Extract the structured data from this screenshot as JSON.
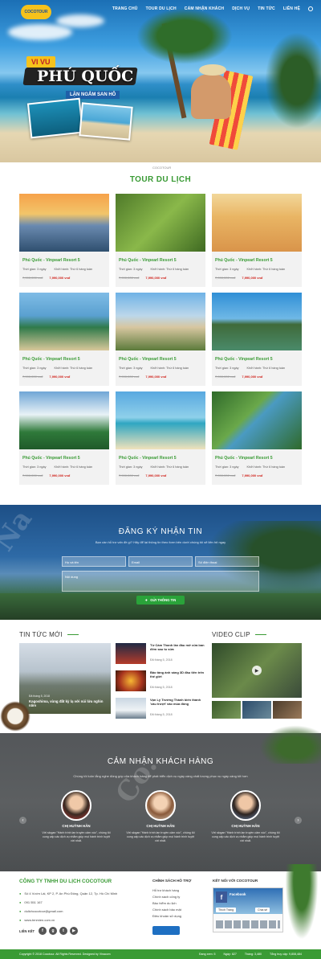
{
  "nav": {
    "items": [
      "TRANG CHỦ",
      "TOUR DU LỊCH",
      "CẨM NHẬN KHÁCH",
      "DỊCH VỤ",
      "TIN TỨC",
      "LIÊN HỆ"
    ],
    "logo": "COCOTOUR"
  },
  "hero": {
    "tag": "VI VU",
    "title": "PHÚ QUỐC",
    "subtitle": "LẶN NGẮM SAN HÔ"
  },
  "tour": {
    "mini_logo": "COCOTOUR",
    "title": "TOUR DU LỊCH",
    "cards": [
      {
        "name": "Phú Quốc - Vinpearl Resort 5",
        "duration": "Thời gian: 3 ngày",
        "depart": "Khởi hành: Thứ 6 hàng tuần",
        "old_price": "7,990,000 vnđ",
        "new_price": "7,990,000 vnđ",
        "img": "sunset"
      },
      {
        "name": "Phú Quốc - Vinpearl Resort 5",
        "duration": "Thời gian: 3 ngày",
        "depart": "Khởi hành: Thứ 6 hàng tuần",
        "old_price": "7,990,000 vnđ",
        "new_price": "7,990,000 vnđ",
        "img": "grapes"
      },
      {
        "name": "Phú Quốc - Vinpearl Resort 5",
        "duration": "Thời gian: 3 ngày",
        "depart": "Khởi hành: Thứ 6 hàng tuần",
        "old_price": "7,990,000 vnđ",
        "new_price": "7,990,000 vnđ",
        "img": "dunes"
      },
      {
        "name": "Phú Quốc - Vinpearl Resort 5",
        "duration": "Thời gian: 3 ngày",
        "depart": "Khởi hành: Thứ 6 hàng tuần",
        "old_price": "7,990,000 vnđ",
        "new_price": "7,990,000 vnđ",
        "img": "bay"
      },
      {
        "name": "Phú Quốc - Vinpearl Resort 5",
        "duration": "Thời gian: 3 ngày",
        "depart": "Khởi hành: Thứ 6 hàng tuần",
        "old_price": "7,990,000 vnđ",
        "new_price": "7,990,000 vnđ",
        "img": "temple"
      },
      {
        "name": "Phú Quốc - Vinpearl Resort 5",
        "duration": "Thời gian: 3 ngày",
        "depart": "Khởi hành: Thứ 6 hàng tuần",
        "old_price": "7,990,000 vnđ",
        "new_price": "7,990,000 vnđ",
        "img": "lake"
      },
      {
        "name": "Phú Quốc - Vinpearl Resort 5",
        "duration": "Thời gian: 3 ngày",
        "depart": "Khởi hành: Thứ 6 hàng tuần",
        "old_price": "7,990,000 vnđ",
        "new_price": "7,990,000 vnđ",
        "img": "waterfall"
      },
      {
        "name": "Phú Quốc - Vinpearl Resort 5",
        "duration": "Thời gian: 3 ngày",
        "depart": "Khởi hành: Thứ 6 hàng tuần",
        "old_price": "7,990,000 vnđ",
        "new_price": "7,990,000 vnđ",
        "img": "beach"
      },
      {
        "name": "Phú Quốc - Vinpearl Resort 5",
        "duration": "Thời gian: 3 ngày",
        "depart": "Khởi hành: Thứ 6 hàng tuần",
        "old_price": "7,990,000 vnđ",
        "new_price": "7,990,000 vnđ",
        "img": "river"
      }
    ]
  },
  "newsletter": {
    "title": "ĐĂNG KÝ NHẬN TIN",
    "subtitle": "Bạn cần hỗ trợ vấn đề gì? Hãy để lại thông tin theo form bên dưới chúng tôi sẽ liên hệ ngay",
    "name_placeholder": "Họ và tên",
    "email_placeholder": "Email",
    "phone_placeholder": "Số điện thoại",
    "content_placeholder": "Nội dung",
    "submit": "GỬI THÔNG TIN"
  },
  "news": {
    "title": "TIN TỨC MỚI",
    "featured": {
      "title": "Kagoshima, vùng đất kỳ lạ với núi lửa nghìn năm",
      "date": "Đã tháng 5, 2018"
    },
    "items": [
      {
        "title": "Từ Cám Thanh lần đầu mở cửa ban đêm sau tu sửa",
        "date": "Đã tháng 5, 2018"
      },
      {
        "title": "Bảo tàng ánh sáng 3D đầu tiên trên thế giới",
        "date": "Đã tháng 5, 2018"
      },
      {
        "title": "Vạn Lý Trường Thành biến thành 'cầu trượt' vào mùa đông",
        "date": "Đã tháng 5, 2018"
      }
    ]
  },
  "video": {
    "title": "VIDEO CLIP"
  },
  "testimonials": {
    "title": "CẢM NHẬN KHÁCH HÀNG",
    "subtitle": "Chúng tôi luôn lắng nghe đóng góp của khách hàng để phát triển dịch vụ ngày càng chất lượng phục vụ ngày càng tốt hơn",
    "items": [
      {
        "name": "CHỊ HUỲNH HÂN",
        "quote": "Với slogan \"Hành trình lan truyền cảm xúc\", chúng tôi cung cấp các dịch vụ nhằm giúp mọi hành trình tuyệt vời nhất."
      },
      {
        "name": "CHỊ HUỲNH HÂN",
        "quote": "Với slogan \"Hành trình lan truyền cảm xúc\", chúng tôi cung cấp các dịch vụ nhằm giúp mọi hành trình tuyệt vời nhất."
      },
      {
        "name": "CHỊ HUỲNH HÂN",
        "quote": "Với slogan \"Hành trình lan truyền cảm xúc\", chúng tôi cung cấp các dịch vụ nhằm giúp mọi hành trình tuyệt vời nhất."
      }
    ]
  },
  "footer": {
    "company": "CÔNG TY TNHH DU LỊCH COCOTOUR",
    "address": "Số 4 Vườn Lài, KP 2, P. An Phú Đông, Quận 12, Tp. Hồ Chí Minh",
    "phone": "091 551 167",
    "email": "dulichcocotour@gmail.com",
    "web": "www.tenmien.com.vn",
    "social_label": "LIÊN KẾT",
    "policy_title": "CHÍNH SÁCH HỖ TRỢ",
    "policy_links": [
      "Hỗ trợ khách hàng",
      "Chính sách công ty",
      "Bảo hiểm du lịch",
      "Chính sách bảo mật",
      "Điều khoản sử dụng"
    ],
    "connect_title": "KẾT NỐI VỚI COCOTOUR",
    "fb_page": "Facebook",
    "fb_like": "Thích Trang",
    "fb_share": "Chia sẻ",
    "copyright": "Copyright © 2018 Cocotour. All Rights Reserved. Designed by Vinacom",
    "stats": [
      "Đang xem: 5",
      "Ngày: 827",
      "Tháng: 3,480",
      "Tổng truy cập: 9,808,484"
    ]
  },
  "colors": {
    "green": "#3a9b35",
    "red": "#d0221b",
    "yellow": "#f6c21b"
  }
}
